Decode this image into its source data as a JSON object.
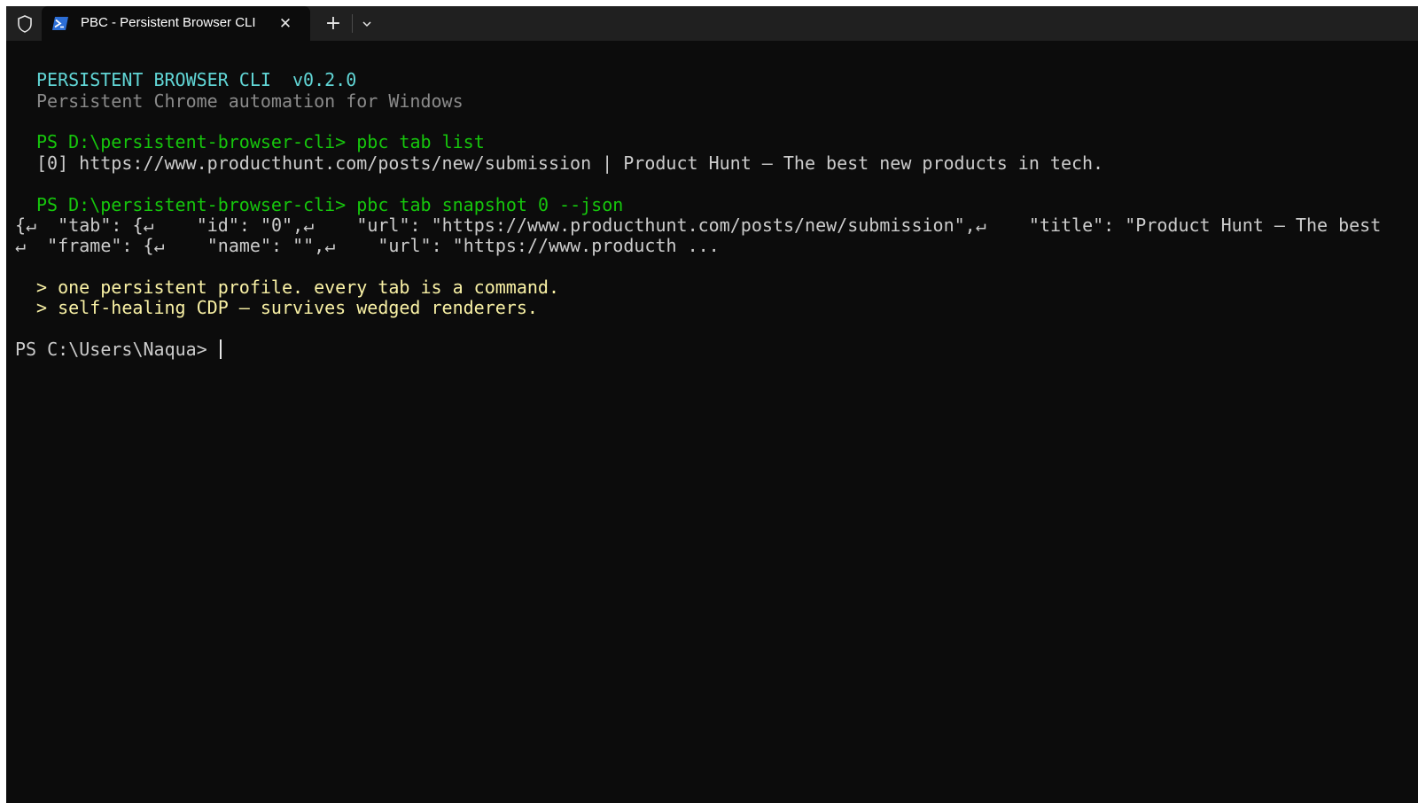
{
  "tab": {
    "title": "PBC - Persistent Browser CLI",
    "close_icon": "close-icon",
    "app_icon": "powershell-icon"
  },
  "titlebar": {
    "new_tab_icon": "plus-icon",
    "dropdown_icon": "chevron-down-icon",
    "shield_icon": "shield-icon"
  },
  "terminal": {
    "banner_title": "PERSISTENT BROWSER CLI  v0.2.0",
    "banner_subtitle": "Persistent Chrome automation for Windows",
    "cmd1_prompt": "PS D:\\persistent-browser-cli>",
    "cmd1": "pbc tab list",
    "cmd1_output": "[0] https://www.producthunt.com/posts/new/submission | Product Hunt – The best new products in tech.",
    "cmd2_prompt": "PS D:\\persistent-browser-cli>",
    "cmd2": "pbc tab snapshot 0 --json",
    "json_line1": "{↵  \"tab\": {↵    \"id\": \"0\",↵    \"url\": \"https://www.producthunt.com/posts/new/submission\",↵    \"title\": \"Product Hunt – The best",
    "json_line2": "↵  \"frame\": {↵    \"name\": \"\",↵    \"url\": \"https://www.producth ...",
    "tagline1": "> one persistent profile. every tab is a command.",
    "tagline2": "> self-healing CDP – survives wedged renderers.",
    "final_prompt": "PS C:\\Users\\Naqua>"
  },
  "colors": {
    "background": "#0c0c0c",
    "titlebar": "#202020",
    "cyan": "#61d6d6",
    "green": "#16c60c",
    "yellow": "#f9f1a5",
    "text": "#cccccc",
    "dim": "#8a8a8a"
  }
}
